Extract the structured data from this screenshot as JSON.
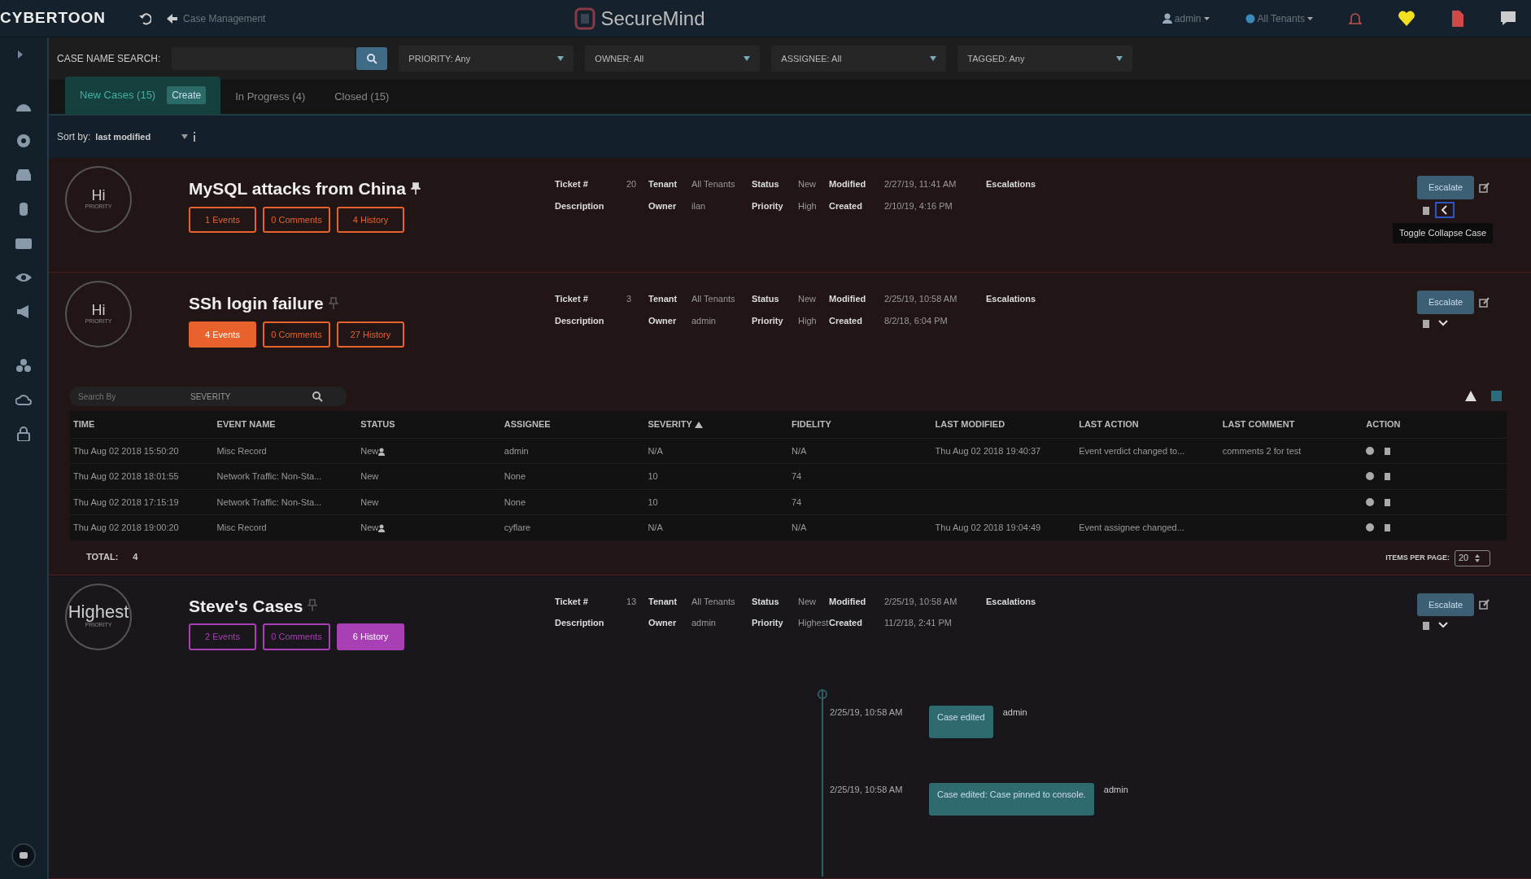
{
  "topbar": {
    "logo": "CYBERTOON",
    "back_label": "Case Management",
    "product": "SecureMind",
    "user": "admin",
    "tenant": "All Tenants"
  },
  "filters": {
    "search_label": "CASE NAME SEARCH:",
    "dropdowns": [
      "PRIORITY: Any",
      "OWNER: All",
      "ASSIGNEE: All",
      "TAGGED: Any"
    ]
  },
  "tabs": [
    {
      "label": "New Cases (15)",
      "selected": true,
      "action": "Create"
    },
    {
      "label": "In Progress (4)",
      "selected": false
    },
    {
      "label": "Closed (15)",
      "selected": false
    }
  ],
  "sort": {
    "label": "Sort by:",
    "value": "last modified"
  },
  "cases": [
    {
      "title": "MySQL attacks from China",
      "pinned": true,
      "color": "#e8622c",
      "priority": "Hi",
      "priority_label": "PRIORITY",
      "collapsed": true,
      "tooltip": "Toggle Collapse Case",
      "buttons": [
        {
          "label": "1 Events",
          "selected": false
        },
        {
          "label": "0 Comments",
          "selected": false
        },
        {
          "label": "4 History",
          "selected": false
        }
      ],
      "meta": [
        [
          {
            "label": "Ticket #",
            "value": "20"
          },
          {
            "label": "Tenant",
            "value": "All Tenants"
          },
          {
            "label": "Status",
            "value": "New"
          },
          {
            "label": "Modified",
            "value": "2/27/19, 11:41 AM"
          },
          {
            "label": "Escalations"
          }
        ],
        [
          {
            "label": "Description"
          },
          {
            "label": "Owner",
            "value": "ilan"
          },
          {
            "label": "Priority",
            "value": "High"
          },
          {
            "label": "Created",
            "value": "2/10/19, 4:16 PM"
          }
        ]
      ],
      "escalate": "Escalate"
    },
    {
      "title": "SSh login failure",
      "pinned": false,
      "color": "#e8622c",
      "priority": "Hi",
      "priority_label": "PRIORITY",
      "collapsed": false,
      "buttons": [
        {
          "label": "4 Events",
          "selected": true
        },
        {
          "label": "0 Comments",
          "selected": false
        },
        {
          "label": "27 History",
          "selected": false
        }
      ],
      "meta": [
        [
          {
            "label": "Ticket #",
            "value": "3"
          },
          {
            "label": "Tenant",
            "value": "All Tenants"
          },
          {
            "label": "Status",
            "value": "New"
          },
          {
            "label": "Modified",
            "value": "2/25/19, 10:58 AM"
          },
          {
            "label": "Escalations"
          }
        ],
        [
          {
            "label": "Description"
          },
          {
            "label": "Owner",
            "value": "admin"
          },
          {
            "label": "Priority",
            "value": "High"
          },
          {
            "label": "Created",
            "value": "8/2/18, 6:04 PM"
          }
        ]
      ],
      "escalate": "Escalate",
      "events": {
        "search_placeholder": "Search By",
        "search_field": "SEVERITY",
        "columns": [
          {
            "label": "TIME",
            "sorted": false
          },
          {
            "label": "EVENT NAME",
            "sorted": false
          },
          {
            "label": "STATUS",
            "sorted": false
          },
          {
            "label": "ASSIGNEE",
            "sorted": false
          },
          {
            "label": "SEVERITY",
            "sorted": true
          },
          {
            "label": "FIDELITY",
            "sorted": false
          },
          {
            "label": "LAST MODIFIED",
            "sorted": false
          },
          {
            "label": "LAST ACTION",
            "sorted": false
          },
          {
            "label": "LAST COMMENT",
            "sorted": false
          },
          {
            "label": "ACTION",
            "sorted": false
          }
        ],
        "rows": [
          {
            "time": "Thu Aug 02 2018 15:50:20",
            "name": "Misc Record",
            "status": "New",
            "assigned": true,
            "assignee": "admin",
            "severity": "N/A",
            "fidelity": "N/A",
            "last_modified": "Thu Aug 02 2018 19:40:37",
            "last_action": "Event verdict changed to...",
            "last_comment": "comments 2 for test"
          },
          {
            "time": "Thu Aug 02 2018 18:01:55",
            "name": "Network Traffic: Non-Sta...",
            "status": "New",
            "assigned": false,
            "assignee": "None",
            "severity": "10",
            "fidelity": "74"
          },
          {
            "time": "Thu Aug 02 2018 17:15:19",
            "name": "Network Traffic: Non-Sta...",
            "status": "New",
            "assigned": false,
            "assignee": "None",
            "severity": "10",
            "fidelity": "74"
          },
          {
            "time": "Thu Aug 02 2018 19:00:20",
            "name": "Misc Record",
            "status": "New",
            "assigned": true,
            "assignee": "cyflare",
            "severity": "N/A",
            "fidelity": "N/A",
            "last_modified": "Thu Aug 02 2018 19:04:49",
            "last_action": "Event assignee changed..."
          }
        ],
        "total_label": "TOTAL:",
        "total": "4",
        "per_page_label": "ITEMS PER PAGE:",
        "per_page": "20"
      }
    },
    {
      "title": "Steve's Cases",
      "pinned": false,
      "color": "#a93fb5",
      "priority": "Highest",
      "priority_label": "PRIORITY",
      "collapsed": false,
      "buttons": [
        {
          "label": "2 Events",
          "selected": false
        },
        {
          "label": "0 Comments",
          "selected": false
        },
        {
          "label": "6 History",
          "selected": true
        }
      ],
      "meta": [
        [
          {
            "label": "Ticket #",
            "value": "13"
          },
          {
            "label": "Tenant",
            "value": "All Tenants"
          },
          {
            "label": "Status",
            "value": "New"
          },
          {
            "label": "Modified",
            "value": "2/25/19, 10:58 AM"
          },
          {
            "label": "Escalations"
          }
        ],
        [
          {
            "label": "Description"
          },
          {
            "label": "Owner",
            "value": "admin"
          },
          {
            "label": "Priority",
            "value": "Highest"
          },
          {
            "label": "Created",
            "value": "11/2/18, 2:41 PM"
          }
        ]
      ],
      "escalate": "Escalate",
      "timeline": [
        {
          "time": "2/25/19, 10:58 AM",
          "text": "Case edited",
          "user": "admin"
        },
        {
          "time": "2/25/19, 10:58 AM",
          "text": "Case edited: Case pinned to console.",
          "user": "admin"
        }
      ]
    }
  ]
}
